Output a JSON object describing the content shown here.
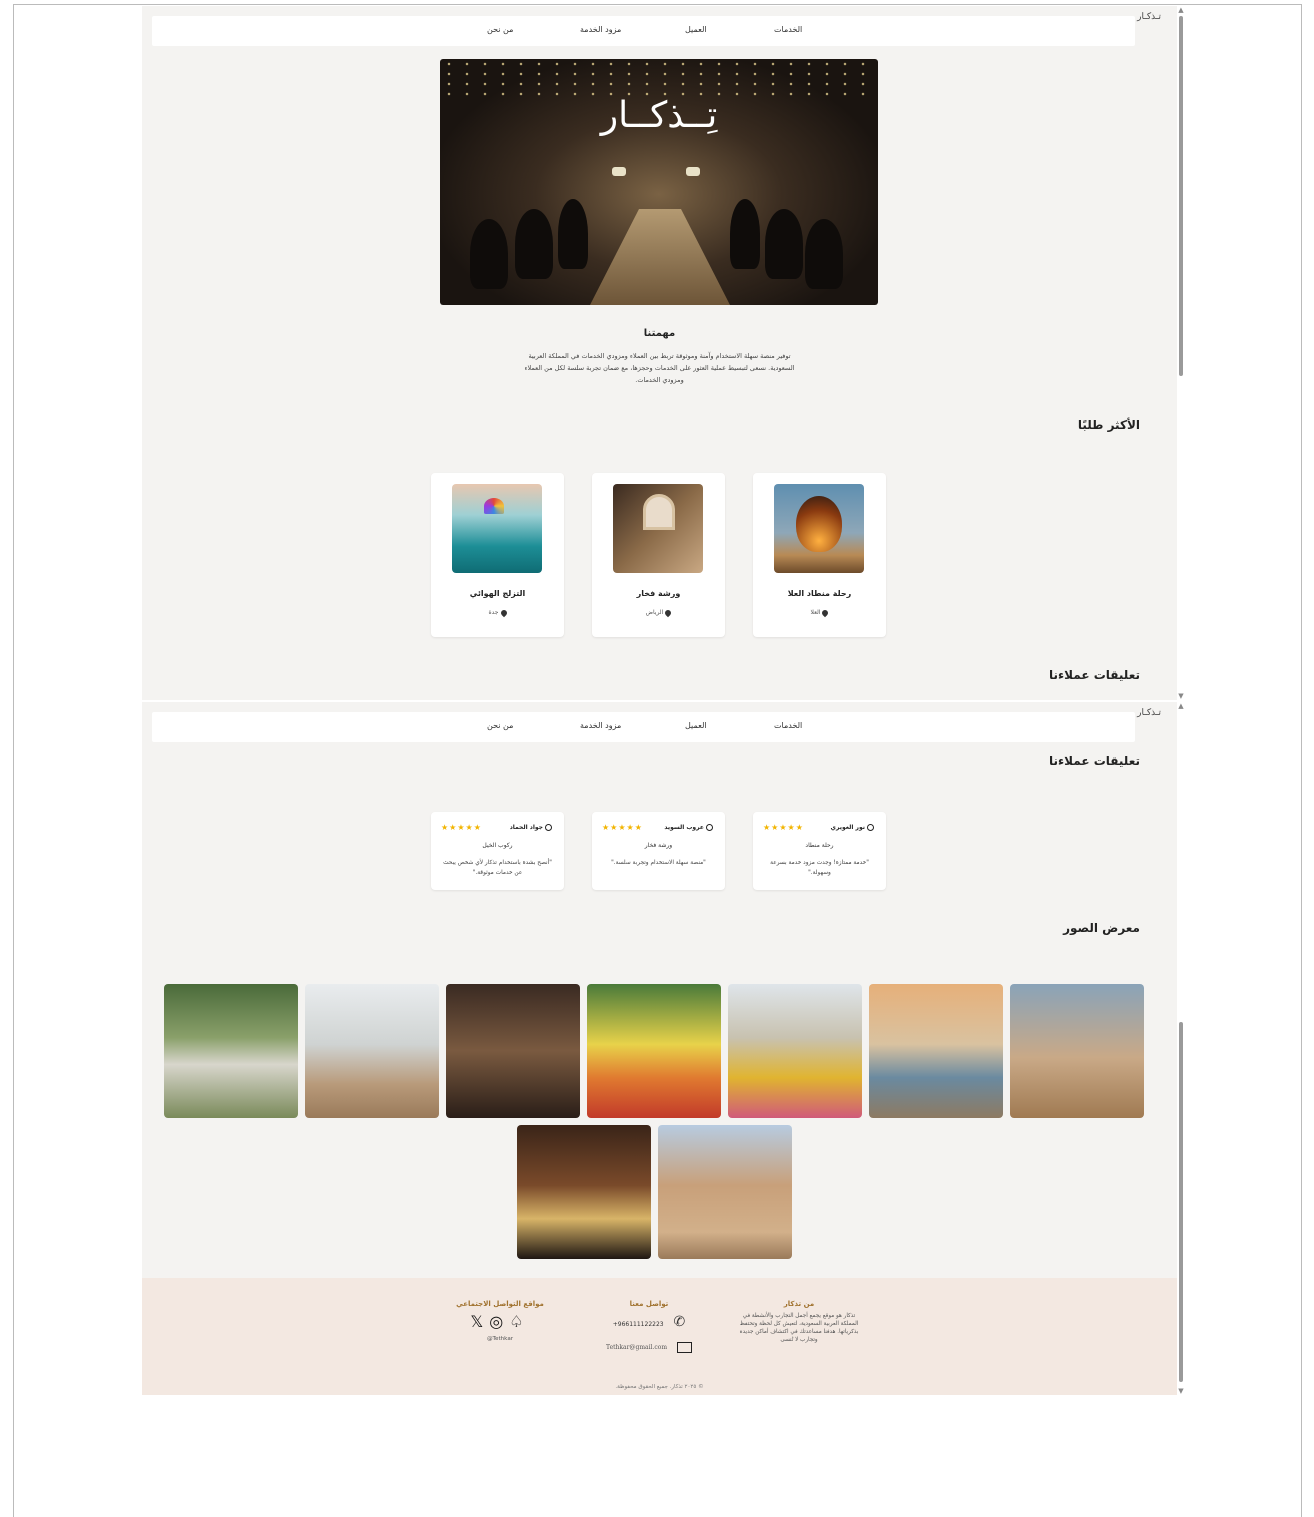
{
  "nav": {
    "logo": "تـذكـار",
    "items": [
      "الخدمات",
      "العميل",
      "مزود الخدمة",
      "من نحن"
    ]
  },
  "hero": {
    "brand": "تِــذكــار"
  },
  "mission": {
    "title": "مهمتنا",
    "text": "توفير منصة سهلة الاستخدام وآمنة وموثوقة تربط بين العملاء ومزودي الخدمات في المملكة العربية السعودية. نسعى لتبسيط عملية العثور على الخدمات وحجزها، مع ضمان تجربة سلسة لكل من العملاء ومزودي الخدمات."
  },
  "popular": {
    "title": "الأكثر طلبًا",
    "cards": [
      {
        "title": "رحلة منطاد العلا",
        "location": "العلا"
      },
      {
        "title": "ورشة فخار",
        "location": "الرياض"
      },
      {
        "title": "التزلج الهوائي",
        "location": "جدة"
      }
    ]
  },
  "reviews": {
    "title": "تعليقات عملاءنا",
    "items": [
      {
        "name": "نور الغويري",
        "stars": "★★★★★",
        "service": "رحلة منطاد",
        "text": "\"خدمة ممتازة! وجدت مزود خدمة بسرعة وسهولة.\""
      },
      {
        "name": "عروب السويد",
        "stars": "★★★★★",
        "service": "ورشة فخار",
        "text": "\"منصة سهلة الاستخدام وتجربة سلسة.\""
      },
      {
        "name": "جواد الحماد",
        "stars": "★★★★★",
        "service": "ركوب الخيل",
        "text": "\"أنصح بشدة باستخدام تذكار لأي شخص يبحث عن خدمات موثوقة.\""
      }
    ]
  },
  "gallery": {
    "title": "معرض الصور"
  },
  "footer": {
    "about_title": "من تذكار",
    "about_text": "تذكار هو موقع يجمع أجمل التجارب والأنشطة في المملكة العربية السعودية، لتعيش كل لحظة وتحتفظ بذكرياتها. هدفنا مساعدتك في اكتشاف أماكن جديدة وتجارب لا تُنسى",
    "contact_title": "تواصل معنا",
    "phone": "+966111122223",
    "email": "Tethkar@gmail.com",
    "social_title": "مواقع التواصل الاجتماعي",
    "handle": "@Tethkar",
    "copyright": "© ٢٠٢٥ تذكار. جميع الحقوق محفوظة."
  }
}
